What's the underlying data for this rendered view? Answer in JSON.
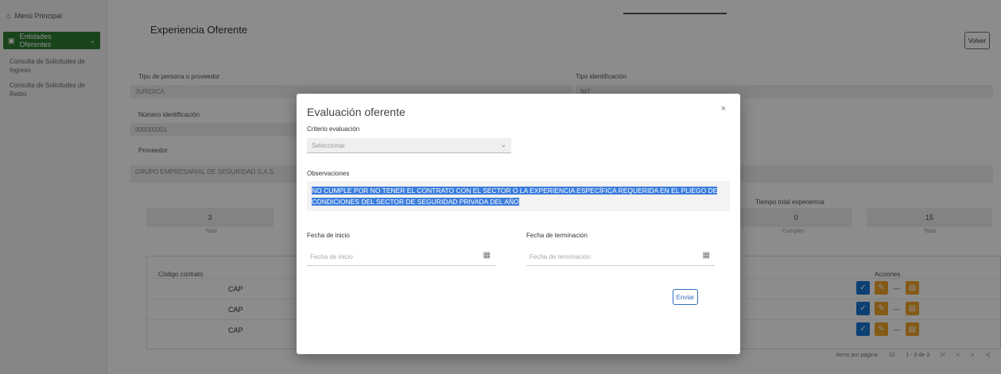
{
  "sidebar": {
    "top_item": "Menú Principal",
    "active_item": "Entidades Oferentes",
    "sub_items": [
      "Consulta de Solicitudes de Ingreso",
      "Consulta de Solicitudes de Retiro"
    ]
  },
  "page": {
    "title": "Experiencia Oferente",
    "back_label": "Volver",
    "fields": {
      "tipo_persona_label": "Tipo de persona o proveedor",
      "tipo_persona_value": "JURIDICA",
      "tipo_identificacion_label": "Tipo identificación",
      "tipo_identificacion_value": "NIT",
      "numero_identificacion_label": "Número identificación",
      "numero_identificacion_value": "900000001",
      "proveedor_label": "Proveedor",
      "proveedor_value": "GRUPO EMPRESARIAL DE SEGURIDAD S.A.S."
    },
    "stats": [
      {
        "value": "3",
        "caption": "Total"
      },
      {
        "value": "0",
        "caption": "Cumplen"
      },
      {
        "value": "15",
        "caption": "Total"
      }
    ],
    "stats_right_label": "Tiempo total experiencia",
    "table": {
      "header_left": "Código contrato",
      "header_actions": "Acciones",
      "rows": [
        {
          "code": "CAP"
        },
        {
          "code": "CAP"
        },
        {
          "code": "CAP"
        }
      ]
    },
    "pager": [
      "Items por página",
      "10",
      "1 - 3 de 3",
      "|<",
      "<",
      ">",
      ">|"
    ]
  },
  "modal": {
    "title": "Evaluación oferente",
    "close_icon": "×",
    "criterion_label": "Criterio evaluación",
    "criterion_value": "Seleccionar",
    "observaciones_label": "Observaciones",
    "observaciones_text": "NO CUMPLE POR NO TENER EL CONTRATO CON EL SECTOR O LA EXPERIENCIA ESPECÍFICA REQUERIDA EN EL PLIEGO DE CONDICIONES DEL SECTOR DE SEGURIDAD PRIVADA DEL AÑO",
    "fecha_inicio_label": "Fecha de inicio",
    "fecha_inicio_placeholder": "Fecha de inicio",
    "fecha_terminacion_label": "Fecha de terminación",
    "fecha_terminacion_placeholder": "Fecha de terminación",
    "save_label": "Enviar"
  },
  "colors": {
    "sidebar_active": "#2e7d32",
    "action_blue": "#1976d2",
    "action_orange": "#f0a42b",
    "selection": "#3b7ddd"
  }
}
